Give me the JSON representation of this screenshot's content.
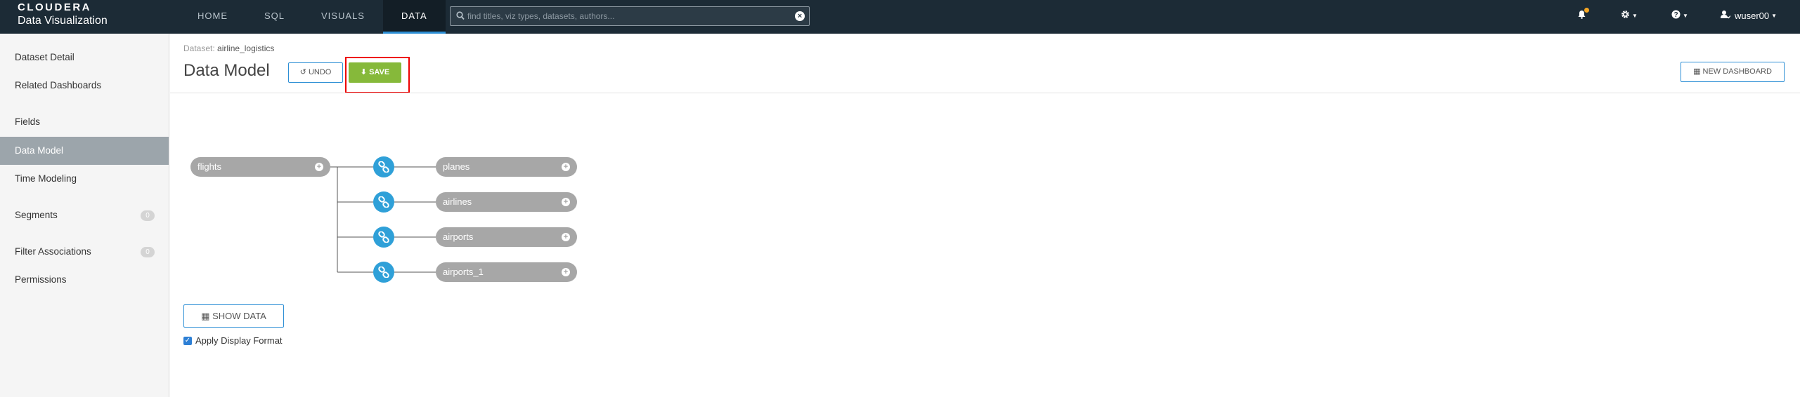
{
  "brand": {
    "name": "CLOUDERA",
    "product": "Data Visualization"
  },
  "nav": {
    "tabs": [
      {
        "label": "HOME"
      },
      {
        "label": "SQL"
      },
      {
        "label": "VISUALS"
      },
      {
        "label": "DATA",
        "active": true
      }
    ]
  },
  "search": {
    "placeholder": "find titles, viz types, datasets, authors..."
  },
  "user": {
    "name": "wuser00"
  },
  "sidebar": {
    "items": [
      {
        "label": "Dataset Detail"
      },
      {
        "label": "Related Dashboards"
      },
      {
        "label": "Fields"
      },
      {
        "label": "Data Model",
        "active": true
      },
      {
        "label": "Time Modeling"
      },
      {
        "label": "Segments",
        "badge": "0"
      },
      {
        "label": "Filter Associations",
        "badge": "0"
      },
      {
        "label": "Permissions"
      }
    ]
  },
  "breadcrumb": {
    "prefix": "Dataset:",
    "dataset": "airline_logistics"
  },
  "page": {
    "title": "Data Model"
  },
  "buttons": {
    "undo": "UNDO",
    "save": "SAVE",
    "new_dashboard": "NEW DASHBOARD",
    "show_data": "SHOW DATA"
  },
  "model": {
    "root": "flights",
    "joins": [
      "planes",
      "airlines",
      "airports",
      "airports_1"
    ]
  },
  "apply_display_format": {
    "label": "Apply Display Format",
    "checked": true
  },
  "colors": {
    "topbar": "#1c2b36",
    "accent": "#2d8fd5",
    "save": "#86b93a",
    "join_node": "#2fa0d8",
    "table_pill": "#a7a7a7",
    "highlight": "#ee0000"
  }
}
